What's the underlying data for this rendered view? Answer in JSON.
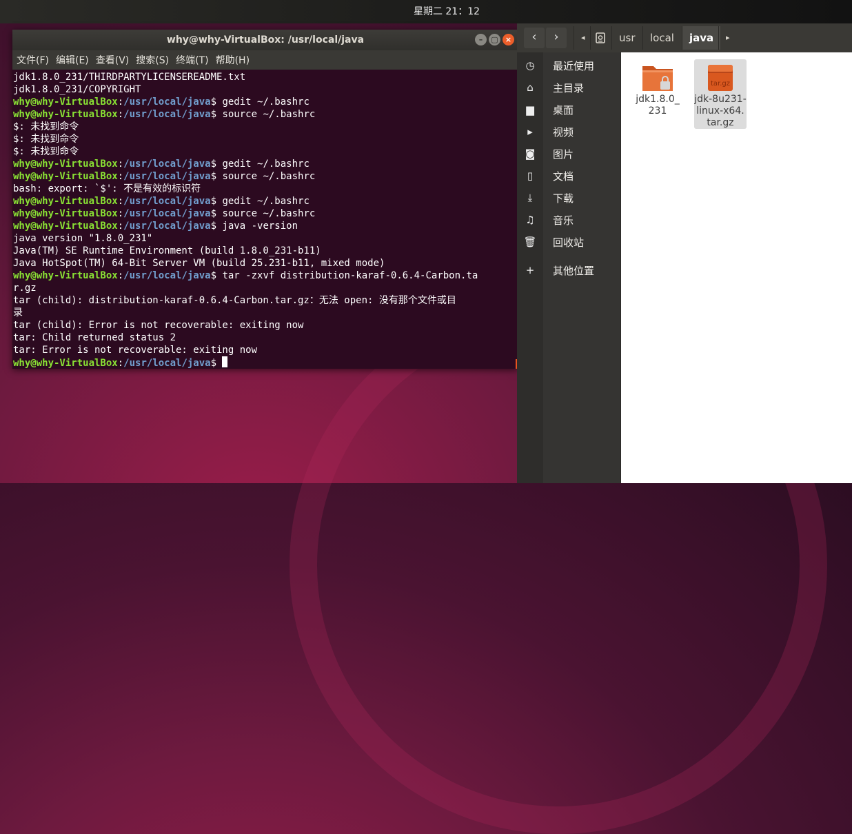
{
  "topbar": {
    "clock": "星期二 21：12"
  },
  "terminal": {
    "title": "why@why-VirtualBox: /usr/local/java",
    "window_buttons": {
      "minimize": "–",
      "maximize": "▢",
      "close": "×"
    },
    "menu": [
      "文件(F)",
      "编辑(E)",
      "查看(V)",
      "搜索(S)",
      "终端(T)",
      "帮助(H)"
    ],
    "prompt_user": "why@why-VirtualBox",
    "prompt_sep": ":",
    "prompt_path": "/usr/local/java",
    "prompt_dollar": "$ ",
    "lines": [
      {
        "text": "jdk1.8.0_231/THIRDPARTYLICENSEREADME.txt"
      },
      {
        "text": "jdk1.8.0_231/COPYRIGHT"
      },
      {
        "prompt": true,
        "text": "gedit ~/.bashrc"
      },
      {
        "prompt": true,
        "text": "source ~/.bashrc"
      },
      {
        "text": "$: 未找到命令"
      },
      {
        "text": "$: 未找到命令"
      },
      {
        "text": "$: 未找到命令"
      },
      {
        "prompt": true,
        "text": "gedit ~/.bashrc"
      },
      {
        "prompt": true,
        "text": "source ~/.bashrc"
      },
      {
        "text": "bash: export: `$': 不是有效的标识符"
      },
      {
        "prompt": true,
        "text": "gedit ~/.bashrc"
      },
      {
        "prompt": true,
        "text": "source ~/.bashrc"
      },
      {
        "prompt": true,
        "text": "java -version"
      },
      {
        "text": "java version \"1.8.0_231\""
      },
      {
        "text": "Java(TM) SE Runtime Environment (build 1.8.0_231-b11)"
      },
      {
        "text": "Java HotSpot(TM) 64-Bit Server VM (build 25.231-b11, mixed mode)"
      },
      {
        "prompt": true,
        "text": "tar -zxvf distribution-karaf-0.6.4-Carbon.ta"
      },
      {
        "text": "r.gz"
      },
      {
        "text": "tar (child): distribution-karaf-0.6.4-Carbon.tar.gz：无法 open: 没有那个文件或目"
      },
      {
        "text": "录"
      },
      {
        "text": "tar (child): Error is not recoverable: exiting now"
      },
      {
        "text": "tar: Child returned status 2"
      },
      {
        "text": "tar: Error is not recoverable: exiting now"
      },
      {
        "prompt": true,
        "text": "",
        "cursor": true
      }
    ]
  },
  "filemanager": {
    "nav": {
      "back": "‹",
      "forward": "›",
      "left_arrow": "◂",
      "right_arrow": "▸"
    },
    "breadcrumbs": [
      "usr",
      "local",
      "java"
    ],
    "sidebar": [
      {
        "icon": "recent-icon",
        "glyph": "◷",
        "label": "最近使用"
      },
      {
        "icon": "home-icon",
        "glyph": "⌂",
        "label": "主目录"
      },
      {
        "icon": "desktop-icon",
        "glyph": "▆",
        "label": "桌面"
      },
      {
        "icon": "videos-icon",
        "glyph": "▸",
        "label": "视频"
      },
      {
        "icon": "pictures-icon",
        "glyph": "◙",
        "label": "图片"
      },
      {
        "icon": "documents-icon",
        "glyph": "▯",
        "label": "文档"
      },
      {
        "icon": "downloads-icon",
        "glyph": "⤓",
        "label": "下载"
      },
      {
        "icon": "music-icon",
        "glyph": "♫",
        "label": "音乐"
      },
      {
        "icon": "trash-icon",
        "glyph": "🗑",
        "label": "回收站"
      },
      {
        "icon": "plus-icon",
        "glyph": "+",
        "label": "其他位置"
      }
    ],
    "files": [
      {
        "icon": "locked-folder-icon",
        "name_lines": [
          "jdk1.8.0_",
          "231"
        ]
      },
      {
        "icon": "archive-icon",
        "badge": "tar.gz",
        "name_lines": [
          "jdk-8u231-",
          "linux-x64.",
          "tar.gz"
        ]
      }
    ]
  },
  "colors": {
    "user": "#8ae234",
    "path": "#729fcf",
    "terminal_bg": "#2c0a20",
    "accent": "#e95420"
  }
}
